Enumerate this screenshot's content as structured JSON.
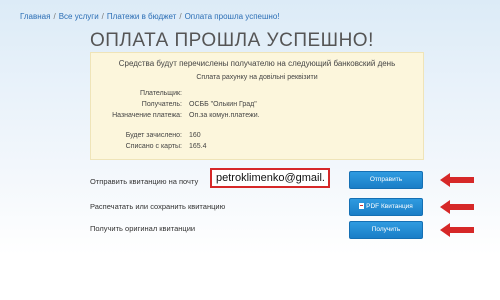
{
  "breadcrumb": {
    "items": [
      "Главная",
      "Все услуги",
      "Платежи в бюджет"
    ],
    "current": "Оплата прошла успешно!",
    "separator": "/"
  },
  "page_title": "ОПЛАТА ПРОШЛА УСПЕШНО!",
  "info": {
    "main_text": "Средства будут перечислены получателю на следующий банковский день",
    "sub_text": "Сплата рахунку на довільні реквізити",
    "rows": [
      {
        "label": "Плательщик:",
        "value": ""
      },
      {
        "label": "Получатель:",
        "value": "ОСББ \"Олькин Град\""
      },
      {
        "label": "Назначение платежа:",
        "value": "Оп.за комун.платежи."
      },
      {
        "label": "Будет зачислено:",
        "value": "160"
      },
      {
        "label": "Списано с карты:",
        "value": "165.4"
      }
    ]
  },
  "actions": [
    {
      "label": "Отправить квитанцию на почту",
      "button": "Отправить"
    },
    {
      "label": "Распечатать или сохранить квитанцию",
      "button": "PDF Квитанция"
    },
    {
      "label": "Получить оригинал квитанции",
      "button": "Получить"
    }
  ],
  "email_input": {
    "value": "petroklimenko@gmail.com"
  },
  "colors": {
    "accent": "#1a7ec7",
    "highlight": "#d62828",
    "info_bg": "#fcf6dc"
  }
}
